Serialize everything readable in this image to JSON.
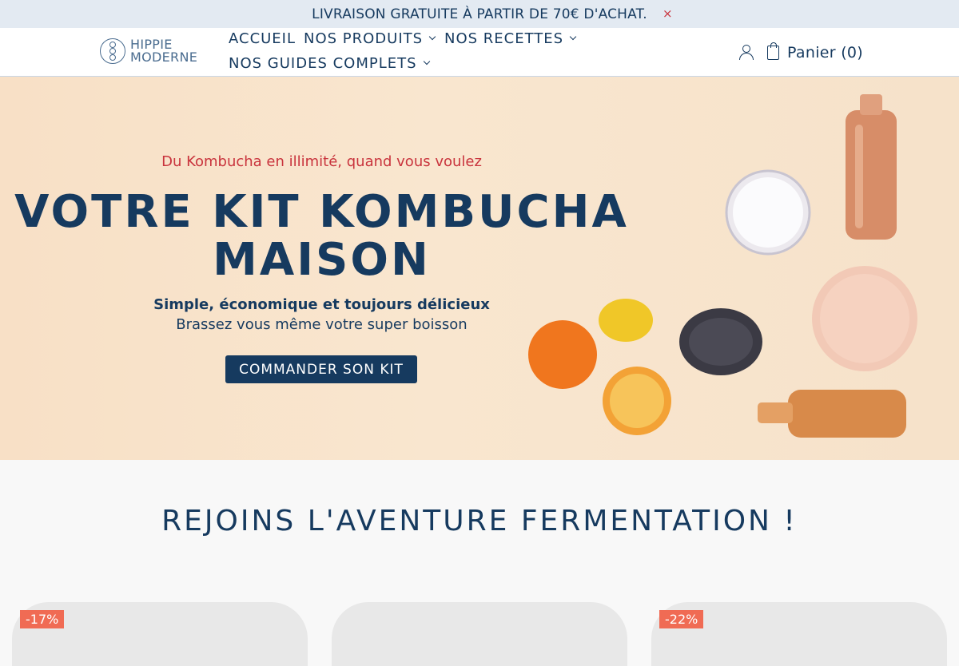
{
  "announcement": {
    "text": "LIVRAISON GRATUITE À PARTIR DE 70€ D'ACHAT.",
    "close": "×"
  },
  "logo": {
    "line1": "HIPPIE",
    "line2": "MODERNE"
  },
  "nav": {
    "items": [
      {
        "label": "ACCUEIL",
        "dropdown": false
      },
      {
        "label": "NOS PRODUITS",
        "dropdown": true
      },
      {
        "label": "NOS RECETTES",
        "dropdown": true
      },
      {
        "label": "NOS GUIDES COMPLETS",
        "dropdown": true
      }
    ]
  },
  "cart": {
    "label": "Panier (0)"
  },
  "hero": {
    "eyebrow": "Du Kombucha en illimité, quand vous voulez",
    "title": "VOTRE KIT KOMBUCHA MAISON",
    "subtitle_bold": "Simple, économique et toujours délicieux",
    "subtitle": "Brassez vous même votre super boisson",
    "cta": "COMMANDER SON KIT"
  },
  "section": {
    "title": "REJOINS L'AVENTURE FERMENTATION !"
  },
  "products": [
    {
      "badge": "-17%"
    },
    {
      "badge": ""
    },
    {
      "badge": "-22%"
    }
  ],
  "colors": {
    "navy": "#163a5f",
    "accent_red": "#c9343d",
    "badge": "#f06b54",
    "hero_bg": "#f8e0c6",
    "announce_bg": "#e3eaf2"
  }
}
